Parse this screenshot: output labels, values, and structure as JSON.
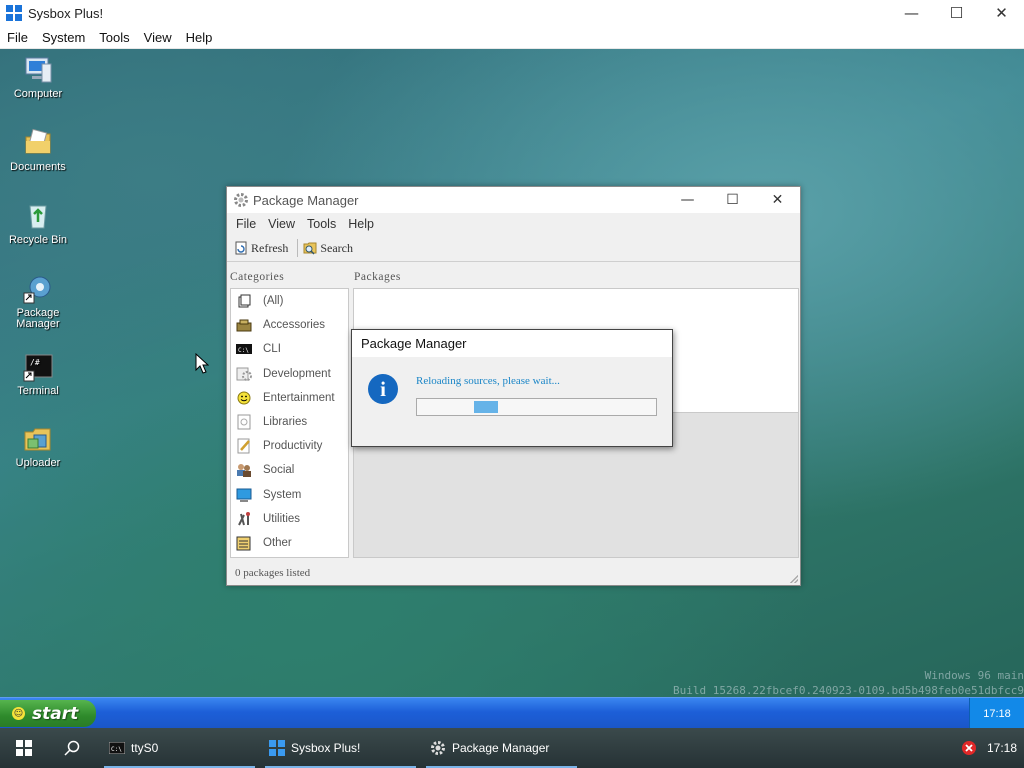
{
  "host": {
    "title": "Sysbox Plus!",
    "controls": [
      "—",
      "☐",
      "✕"
    ],
    "menu": [
      "File",
      "System",
      "Tools",
      "View",
      "Help"
    ]
  },
  "desktop": {
    "icons": [
      {
        "label": "Computer",
        "icon": "computer-icon"
      },
      {
        "label": "Documents",
        "icon": "documents-icon"
      },
      {
        "label": "Recycle Bin",
        "icon": "recycle-bin-icon"
      },
      {
        "label": "Package Manager",
        "icon": "package-manager-icon"
      },
      {
        "label": "Terminal",
        "icon": "terminal-icon"
      },
      {
        "label": "Uploader",
        "icon": "uploader-icon"
      }
    ],
    "watermark_line1": "Windows 96 main",
    "watermark_line2": "Build 15268.22fbcef0.240923-0109.bd5b498feb0e51dbfcc9"
  },
  "package_manager": {
    "title": "Package Manager",
    "controls": [
      "—",
      "☐",
      "✕"
    ],
    "menu": [
      "File",
      "View",
      "Tools",
      "Help"
    ],
    "toolbar": {
      "refresh": "Refresh",
      "search": "Search"
    },
    "categories_label": "Categories",
    "packages_label": "Packages",
    "categories": [
      {
        "label": "(All)",
        "icon": "all-icon"
      },
      {
        "label": "Accessories",
        "icon": "accessories-icon"
      },
      {
        "label": "CLI",
        "icon": "cli-icon"
      },
      {
        "label": "Development",
        "icon": "development-icon"
      },
      {
        "label": "Entertainment",
        "icon": "entertainment-icon"
      },
      {
        "label": "Libraries",
        "icon": "libraries-icon"
      },
      {
        "label": "Productivity",
        "icon": "productivity-icon"
      },
      {
        "label": "Social",
        "icon": "social-icon"
      },
      {
        "label": "System",
        "icon": "system-icon"
      },
      {
        "label": "Utilities",
        "icon": "utilities-icon"
      },
      {
        "label": "Other",
        "icon": "other-icon"
      }
    ],
    "status": "0 packages listed"
  },
  "dialog": {
    "title": "Package Manager",
    "message": "Reloading sources, please wait...",
    "progress_start": 0.24,
    "progress_end": 0.34,
    "colors": {
      "info": "#1568c0",
      "message": "#1b86c7",
      "progress": "#66b3e8"
    }
  },
  "guest_taskbar": {
    "start_label": "start",
    "clock": "17:18"
  },
  "host_taskbar": {
    "items": [
      {
        "label": "ttyS0",
        "icon": "terminal-icon"
      },
      {
        "label": "Sysbox Plus!",
        "icon": "windows-icon"
      },
      {
        "label": "Package Manager",
        "icon": "gear-icon"
      }
    ],
    "clock": "17:18"
  }
}
